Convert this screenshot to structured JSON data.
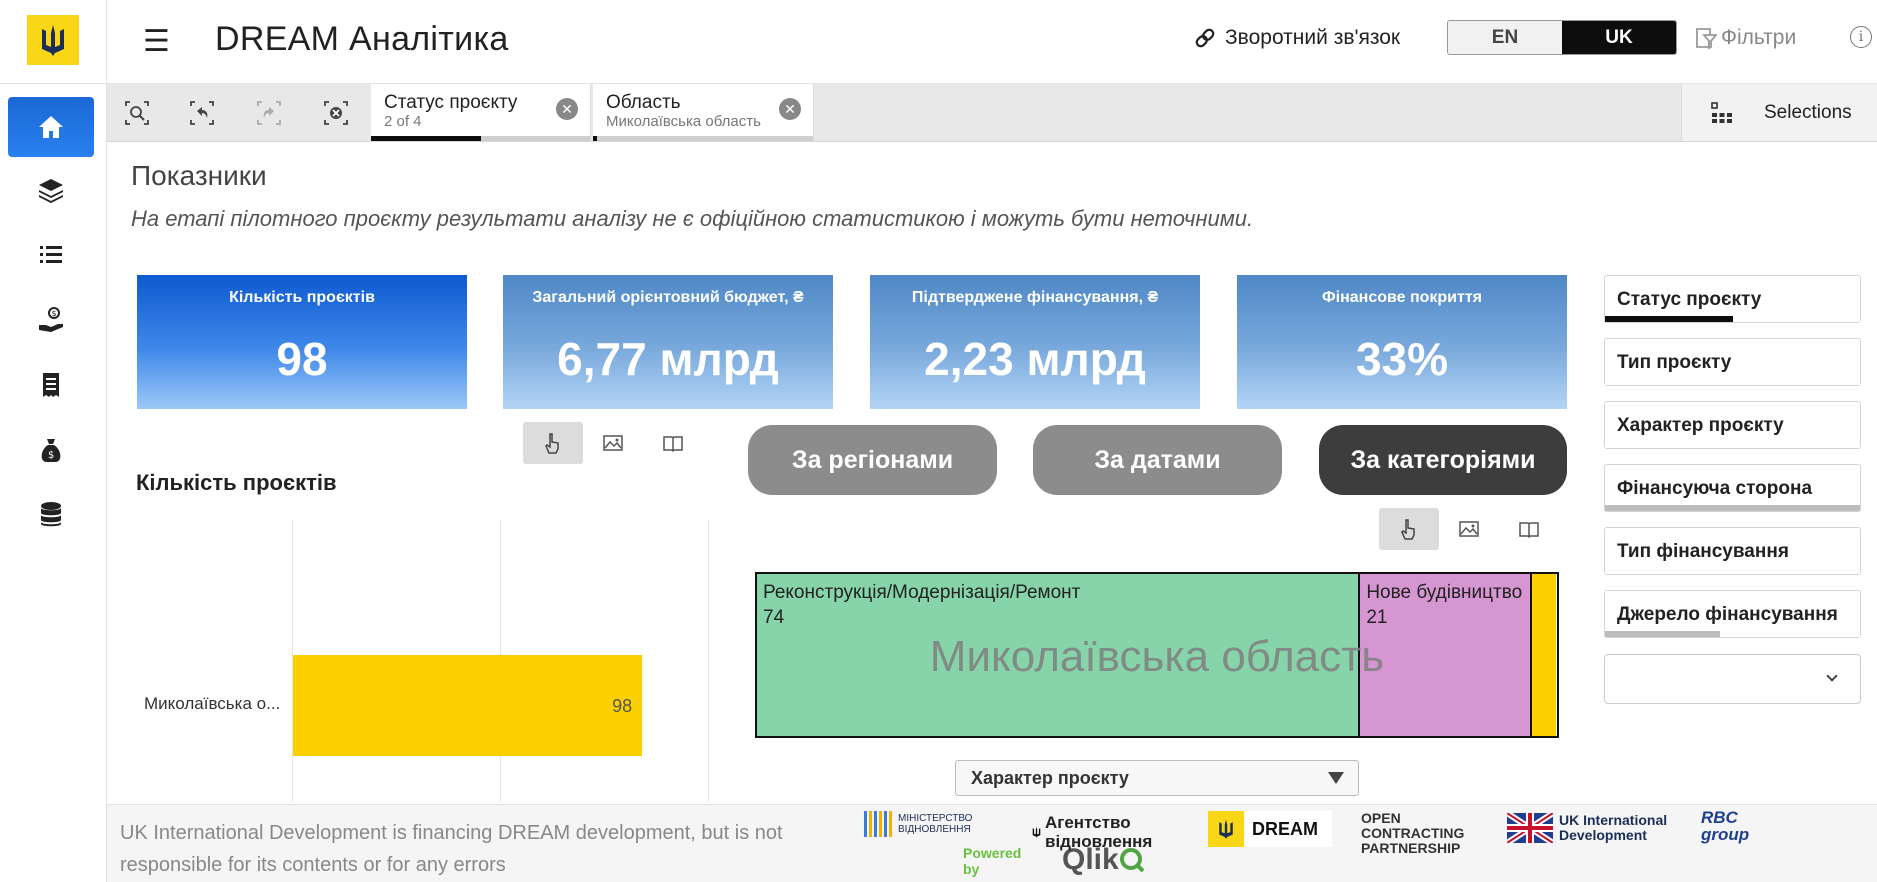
{
  "app": {
    "title": "DREAM Аналітика"
  },
  "header": {
    "feedback_label": "Зворотний зв'язок",
    "lang_en": "EN",
    "lang_uk": "UK",
    "filters_label": "Фільтри"
  },
  "selections": {
    "chips": [
      {
        "title": "Статус проєкту",
        "sub": "2 of 4",
        "fill_fraction": 0.5
      },
      {
        "title": "Область",
        "sub": "Миколаївська область",
        "fill_fraction": 0.02
      }
    ],
    "button_label": "Selections"
  },
  "page": {
    "title": "Показники",
    "disclaimer": "На етапі пілотного проєкту результати аналізу не є офіційною статистикою і можуть бути неточними."
  },
  "kpis": [
    {
      "label": "Кількість проєктів",
      "value": "98"
    },
    {
      "label": "Загальний орієнтовний бюджет, ₴",
      "value": "6,77 млрд"
    },
    {
      "label": "Підтверджене фінансування, ₴",
      "value": "2,23 млрд"
    },
    {
      "label": "Фінансове покриття",
      "value": "33%"
    }
  ],
  "views": {
    "by_regions": "За регіонами",
    "by_dates": "За датами",
    "by_categories": "За категоріями"
  },
  "bar_chart": {
    "title": "Кількість проєктів"
  },
  "chart_data": [
    {
      "type": "bar",
      "orientation": "horizontal",
      "title": "Кількість проєктів",
      "categories": [
        "Миколаївська о..."
      ],
      "values": [
        98
      ],
      "xlim": [
        0,
        120
      ],
      "grid": true
    },
    {
      "type": "treemap",
      "title": "Миколаївська область",
      "categories": [
        "Реконструкція/Модернізація/Ремонт",
        "Нове будівництво",
        ""
      ],
      "values": [
        74,
        21,
        3
      ],
      "colors": [
        "#88d4aa",
        "#d696d2",
        "#fcd000"
      ]
    }
  ],
  "treemap_labels": {
    "watermark": "Миколаївська область",
    "cells": [
      {
        "name": "Реконструкція/Модернізація/Ремонт",
        "value": "74"
      },
      {
        "name": "Нове будівництво",
        "value": "21"
      }
    ]
  },
  "dimension_select": {
    "selected": "Характер проєкту"
  },
  "filters": [
    {
      "label": "Статус проєкту",
      "fill_fraction": 0.5,
      "fill_color": "#0d0d0d"
    },
    {
      "label": "Тип проєкту",
      "fill_fraction": 0,
      "fill_color": "#bdbdbd"
    },
    {
      "label": "Характер проєкту",
      "fill_fraction": 0,
      "fill_color": "#bdbdbd"
    },
    {
      "label": "Фінансуюча сторона",
      "fill_fraction": 1,
      "fill_color": "#bdbdbd"
    },
    {
      "label": "Тип фінансування",
      "fill_fraction": 0,
      "fill_color": "#bdbdbd"
    },
    {
      "label": "Джерело фінансування",
      "fill_fraction": 0.45,
      "fill_color": "#bdbdbd"
    }
  ],
  "footer": {
    "note": "UK International Development is financing DREAM development, but is not responsible for its contents or for any errors",
    "partners": {
      "ministry": "МІНІСТЕРСТВО ВІДНОВЛЕННЯ",
      "agency": "Агентство відновлення",
      "dream": "DREAM",
      "ocp": "OPEN CONTRACTING PARTNERSHIP",
      "ukid": "UK International Development",
      "rbc": "RBC group",
      "powered": "Powered by",
      "qlik": "Qlik"
    }
  },
  "colors": {
    "accent_blue": "#1a68d6",
    "brand_yellow": "#f9d616",
    "bar_yellow": "#fcd000",
    "treemap_green": "#88d4aa",
    "treemap_pink": "#d696d2"
  }
}
